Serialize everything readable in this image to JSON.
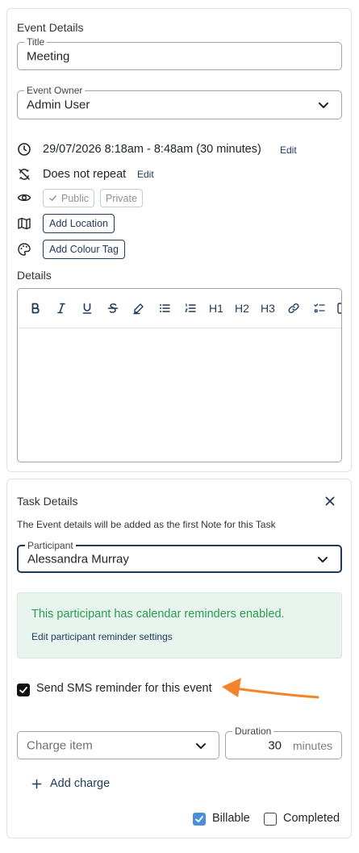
{
  "event_details": {
    "section_title": "Event Details",
    "title_field": {
      "label": "Title",
      "value": "Meeting"
    },
    "owner_field": {
      "label": "Event Owner",
      "value": "Admin User"
    },
    "datetime": {
      "text": "29/07/2026 8:18am - 8:48am (30 minutes)",
      "edit_label": "Edit"
    },
    "repeat": {
      "text": "Does not repeat",
      "edit_label": "Edit"
    },
    "visibility": {
      "public_label": "Public",
      "private_label": "Private",
      "selected": "Public"
    },
    "add_location_label": "Add Location",
    "add_colour_tag_label": "Add Colour Tag",
    "details_label": "Details",
    "toolbar": {
      "h1": "H1",
      "h2": "H2",
      "h3": "H3",
      "buttons": [
        "bold-icon",
        "italic-icon",
        "underline-icon",
        "strikethrough-icon",
        "highlighter-icon",
        "bullet-list-icon",
        "numbered-list-icon",
        "heading-1",
        "heading-2",
        "heading-3",
        "link-icon",
        "checklist-icon",
        "more-icon"
      ]
    }
  },
  "task_details": {
    "section_title": "Task Details",
    "note_text": "The Event details will be added as the first Note for this Task",
    "participant_field": {
      "label": "Participant",
      "value": "Alessandra Murray"
    },
    "alert": {
      "message": "This participant has calendar reminders enabled.",
      "link": "Edit participant reminder settings"
    },
    "sms_reminder": {
      "label": "Send SMS reminder for this event",
      "checked": true
    },
    "charge_item": {
      "placeholder": "Charge item"
    },
    "duration": {
      "label": "Duration",
      "value": "30",
      "unit": "minutes"
    },
    "add_charge_label": "Add charge",
    "billable": {
      "label": "Billable",
      "checked": true
    },
    "completed": {
      "label": "Completed",
      "checked": false
    }
  },
  "colors": {
    "primary": "#1f3a5a",
    "success_text": "#2a9d4f",
    "success_bg": "#e8f5ee",
    "checkbox_blue": "#4a90d9",
    "annotation_arrow": "#f5832a"
  }
}
